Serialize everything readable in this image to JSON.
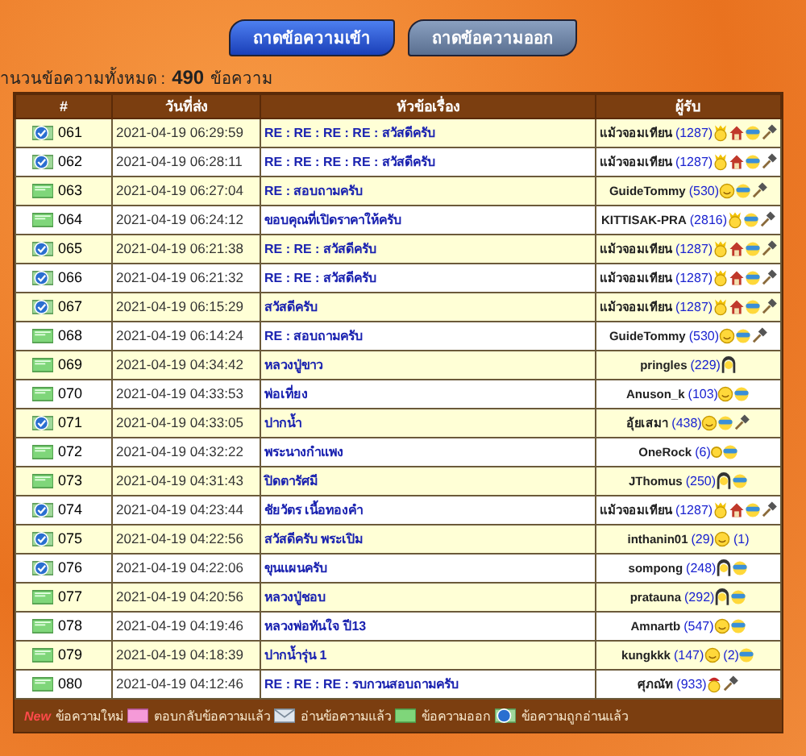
{
  "tabs": [
    {
      "label": "ถาดข้อความเข้า",
      "selected": true
    },
    {
      "label": "ถาดข้อความออก",
      "selected": false
    }
  ],
  "summary": {
    "label": "านวนข้อความทั้งหมด :",
    "count": "490",
    "unit": "ข้อความ"
  },
  "table": {
    "columns": [
      "#",
      "วันที่ส่ง",
      "หัวข้อเรื่อง",
      "ผู้รับ"
    ],
    "rows": [
      {
        "kind": "opened",
        "no": "061",
        "date": "2021-04-19 06:29:59",
        "subject": "RE : RE : RE : RE : สวัสดีครับ",
        "name": "แม้วจอมเทียน",
        "posts": "(1287)",
        "badges": [
          {
            "kind": "crown"
          },
          {
            "kind": "house"
          },
          {
            "kind": "mask"
          },
          {
            "kind": "hammer"
          }
        ]
      },
      {
        "kind": "opened",
        "no": "062",
        "date": "2021-04-19 06:28:11",
        "subject": "RE : RE : RE : RE : สวัสดีครับ",
        "name": "แม้วจอมเทียน",
        "posts": "(1287)",
        "badges": [
          {
            "kind": "crown"
          },
          {
            "kind": "house"
          },
          {
            "kind": "mask"
          },
          {
            "kind": "hammer"
          }
        ]
      },
      {
        "kind": "sent",
        "no": "063",
        "date": "2021-04-19 06:27:04",
        "subject": "RE : สอบถามครับ",
        "name": "GuideTommy",
        "posts": "(530)",
        "badges": [
          {
            "kind": "smiley"
          },
          {
            "kind": "mask"
          },
          {
            "kind": "hammer"
          }
        ]
      },
      {
        "kind": "sent",
        "no": "064",
        "date": "2021-04-19 06:24:12",
        "subject": "ขอบคุณที่เปิดราคาให้ครับ",
        "name": "KITTISAK-PRA",
        "posts": "(2816)",
        "badges": [
          {
            "kind": "crown"
          },
          {
            "kind": "mask"
          },
          {
            "kind": "hammer"
          }
        ]
      },
      {
        "kind": "opened",
        "no": "065",
        "date": "2021-04-19 06:21:38",
        "subject": "RE : RE : สวัสดีครับ",
        "name": "แม้วจอมเทียน",
        "posts": "(1287)",
        "badges": [
          {
            "kind": "crown"
          },
          {
            "kind": "house"
          },
          {
            "kind": "mask"
          },
          {
            "kind": "hammer"
          }
        ]
      },
      {
        "kind": "opened",
        "no": "066",
        "date": "2021-04-19 06:21:32",
        "subject": "RE : RE : สวัสดีครับ",
        "name": "แม้วจอมเทียน",
        "posts": "(1287)",
        "badges": [
          {
            "kind": "crown"
          },
          {
            "kind": "house"
          },
          {
            "kind": "mask"
          },
          {
            "kind": "hammer"
          }
        ]
      },
      {
        "kind": "opened",
        "no": "067",
        "date": "2021-04-19 06:15:29",
        "subject": "สวัสดีครับ",
        "name": "แม้วจอมเทียน",
        "posts": "(1287)",
        "badges": [
          {
            "kind": "crown"
          },
          {
            "kind": "house"
          },
          {
            "kind": "mask"
          },
          {
            "kind": "hammer"
          }
        ]
      },
      {
        "kind": "sent",
        "no": "068",
        "date": "2021-04-19 06:14:24",
        "subject": "RE : สอบถามครับ",
        "name": "GuideTommy",
        "posts": "(530)",
        "badges": [
          {
            "kind": "smiley"
          },
          {
            "kind": "mask"
          },
          {
            "kind": "hammer"
          }
        ]
      },
      {
        "kind": "sent",
        "no": "069",
        "date": "2021-04-19 04:34:42",
        "subject": "หลวงปู่ขาว",
        "name": "pringles",
        "posts": "(229)",
        "badges": [
          {
            "kind": "hood"
          }
        ]
      },
      {
        "kind": "sent",
        "no": "070",
        "date": "2021-04-19 04:33:53",
        "subject": "พ่อเที่ยง",
        "name": "Anuson_k",
        "posts": "(103)",
        "badges": [
          {
            "kind": "smiley"
          },
          {
            "kind": "mask"
          }
        ]
      },
      {
        "kind": "opened",
        "no": "071",
        "date": "2021-04-19 04:33:05",
        "subject": "ปากน้ำ",
        "name": "อุ้ยเสมา",
        "posts": "(438)",
        "badges": [
          {
            "kind": "smiley"
          },
          {
            "kind": "mask"
          },
          {
            "kind": "hammer"
          }
        ]
      },
      {
        "kind": "sent",
        "no": "072",
        "date": "2021-04-19 04:32:22",
        "subject": "พระนางกำแพง",
        "name": "OneRock",
        "posts": "(6)",
        "badges": [
          {
            "kind": "dot"
          },
          {
            "kind": "mask"
          }
        ]
      },
      {
        "kind": "sent",
        "no": "073",
        "date": "2021-04-19 04:31:43",
        "subject": "ปิดตารัศมี",
        "name": "JThomus",
        "posts": "(250)",
        "badges": [
          {
            "kind": "hood"
          },
          {
            "kind": "mask"
          }
        ]
      },
      {
        "kind": "opened",
        "no": "074",
        "date": "2021-04-19 04:23:44",
        "subject": "ชัยวัตร เนื้อทองคำ",
        "name": "แม้วจอมเทียน",
        "posts": "(1287)",
        "badges": [
          {
            "kind": "crown"
          },
          {
            "kind": "house"
          },
          {
            "kind": "mask"
          },
          {
            "kind": "hammer"
          }
        ]
      },
      {
        "kind": "opened",
        "no": "075",
        "date": "2021-04-19 04:22:56",
        "subject": "สวัสดีครับ พระเปิม",
        "name": "inthanin01",
        "posts": "(29)",
        "badges": [
          {
            "kind": "smiley"
          },
          {
            "kind": "note",
            "text": "(1)"
          }
        ]
      },
      {
        "kind": "opened",
        "no": "076",
        "date": "2021-04-19 04:22:06",
        "subject": "ขุนแผนครับ",
        "name": "sompong",
        "posts": "(248)",
        "badges": [
          {
            "kind": "hood"
          },
          {
            "kind": "mask"
          }
        ]
      },
      {
        "kind": "sent",
        "no": "077",
        "date": "2021-04-19 04:20:56",
        "subject": "หลวงปู่ชอบ",
        "name": "prataunа",
        "posts": "(292)",
        "badges": [
          {
            "kind": "hood"
          },
          {
            "kind": "mask"
          }
        ]
      },
      {
        "kind": "sent",
        "no": "078",
        "date": "2021-04-19 04:19:46",
        "subject": "หลวงพ่อทันใจ ปี13",
        "name": "Amnartb",
        "posts": "(547)",
        "badges": [
          {
            "kind": "smiley"
          },
          {
            "kind": "mask"
          }
        ]
      },
      {
        "kind": "sent",
        "no": "079",
        "date": "2021-04-19 04:18:39",
        "subject": "ปากน้ำรุ่น 1",
        "name": "kungkkk",
        "posts": "(147)",
        "badges": [
          {
            "kind": "smiley"
          },
          {
            "kind": "note",
            "text": "(2)"
          },
          {
            "kind": "mask"
          }
        ]
      },
      {
        "kind": "sent",
        "no": "080",
        "date": "2021-04-19 04:12:46",
        "subject": "RE : RE : RE : รบกวนสอบถามครับ",
        "name": "ศุภณัท",
        "posts": "(933)",
        "badges": [
          {
            "kind": "santa"
          },
          {
            "kind": "hammer"
          }
        ]
      }
    ]
  },
  "legend": [
    {
      "kind": "new",
      "tag": "New",
      "label": "ข้อความใหม่"
    },
    {
      "kind": "replied",
      "label": "ตอบกลับข้อความแล้ว"
    },
    {
      "kind": "read",
      "label": "อ่านข้อความแล้ว"
    },
    {
      "kind": "sent",
      "label": "ข้อความออก"
    },
    {
      "kind": "opened",
      "label": "ข้อความถูกอ่านแล้ว"
    }
  ]
}
